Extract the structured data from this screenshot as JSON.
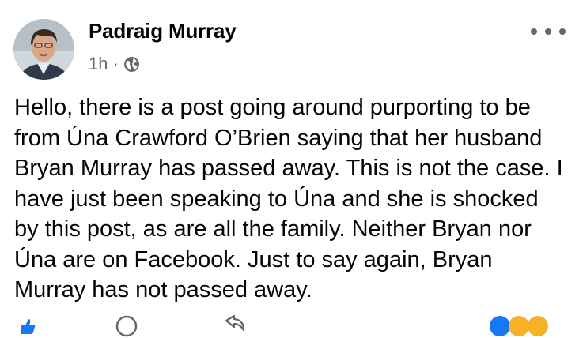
{
  "post": {
    "author": "Padraig Murray",
    "time": "1h",
    "separator": "·",
    "privacy_icon": "globe-icon",
    "more_icon": "more-dots-icon",
    "text": "Hello, there is a post going around purporting to be from Úna Crawford O’Brien saying that her husband Bryan Murray has passed away. This is not the case. I have just been speaking to Úna and she is shocked by this post, as are all the family. Neither Bryan nor Úna are on Facebook. Just to say again, Bryan Murray has not passed away."
  },
  "actions": {
    "like_icon": "thumbs-up-icon",
    "comment_icon": "comment-icon",
    "share_icon": "share-icon",
    "reactions_icon": "reaction-emoji-icons"
  },
  "colors": {
    "text": "#050505",
    "secondary": "#65676b",
    "like_blue": "#1877f2"
  }
}
